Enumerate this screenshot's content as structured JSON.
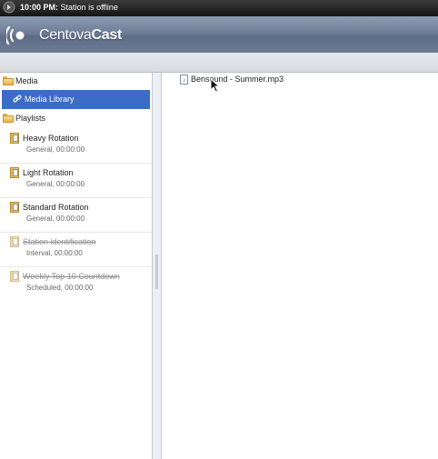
{
  "status": {
    "time": "10:00 PM:",
    "message": "Station is offline"
  },
  "header": {
    "logo_part1": "Centova",
    "logo_part2": "Cast"
  },
  "sidebar": {
    "media_label": "Media",
    "media_library_label": "Media Library",
    "playlists_label": "Playlists",
    "playlists": [
      {
        "name": "Heavy Rotation",
        "meta": "General, 00:00:00",
        "disabled": false
      },
      {
        "name": "Light Rotation",
        "meta": "General, 00:00:00",
        "disabled": false
      },
      {
        "name": "Standard Rotation",
        "meta": "General, 00:00:00",
        "disabled": false
      },
      {
        "name": "Station identification",
        "meta": "Interval, 00:00:00",
        "disabled": true
      },
      {
        "name": "Weekly Top 10 Countdown",
        "meta": "Scheduled, 00:00:00",
        "disabled": true
      }
    ]
  },
  "main": {
    "files": [
      {
        "name": "Bensound - Summer.mp3",
        "icon": "audio-file-icon"
      }
    ]
  },
  "colors": {
    "selection": "#3c6cc7",
    "header": "#6f7e97"
  }
}
